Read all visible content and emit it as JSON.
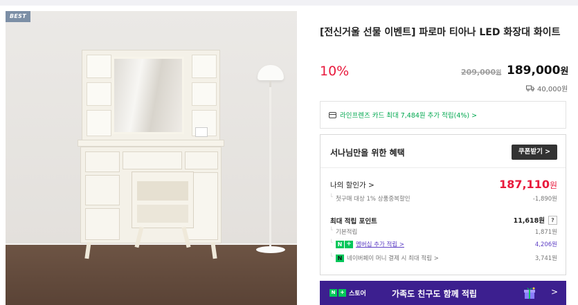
{
  "badge": "BEST",
  "product": {
    "title": "[전신거울 선물 이벤트] 파로마 티아나 LED 화장대 화이트",
    "discount_rate": "10%",
    "original_price": "209,000",
    "original_price_unit": "원",
    "price": "189,000",
    "price_unit": "원",
    "shipping_fee": "40,000원",
    "shipping_icon": "truck-icon"
  },
  "card_point": {
    "icon": "credit-card-icon",
    "text": "라인프렌즈 카드 최대 7,484원 추가 적립(4%) >"
  },
  "benefit": {
    "title": "서나님만을 위한 혜택",
    "coupon_button": "쿠폰받기 >",
    "my_discount_label": "나의 할인가 >",
    "my_discount_value": "187,110",
    "my_discount_unit": "원",
    "first_purchase_label": "첫구매 대상 1% 상품중복할인",
    "first_purchase_value": "-1,890원",
    "max_point_label": "최대 적립 포인트",
    "max_point_value": "11,618원",
    "help_glyph": "?",
    "basic_point_label": "기본적립",
    "basic_point_value": "1,871원",
    "member_badge_n": "N",
    "member_badge_plus": "+",
    "member_label": "멤버십 추가 적립 >",
    "member_value": "4,206원",
    "npay_badge": "N",
    "npay_label": "네이버페이 머니 결제 시 최대 적립 >",
    "npay_value": "3,741원"
  },
  "store_banner": {
    "logo_n": "N",
    "logo_plus": "+",
    "logo_text": "스토어",
    "text": "가족도 친구도 함께 적립",
    "arrow": ">",
    "background": "#3c1f8f"
  },
  "colors": {
    "accent_red": "#e8193c",
    "naver_green": "#03c75a",
    "membership_purple": "#5b3cc4"
  }
}
